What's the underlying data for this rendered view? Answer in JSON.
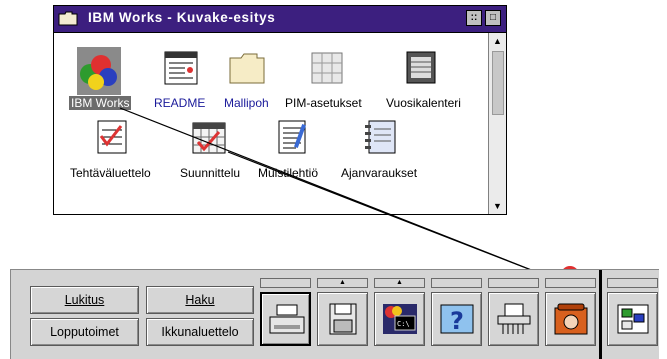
{
  "window": {
    "title": "IBM Works - Kuvake-esitys",
    "restore_glyph": "::",
    "max_glyph": "□"
  },
  "icons": [
    {
      "label": "IBM Works",
      "icon": "ibm-works-balloons-icon",
      "selected": true
    },
    {
      "label": "README",
      "icon": "readme-document-icon"
    },
    {
      "label": "Mallipoh",
      "icon": "folder-icon"
    },
    {
      "label": "PIM-asetukset",
      "icon": "pim-settings-icon"
    },
    {
      "label": "Vuosikalenteri",
      "icon": "year-calendar-icon"
    },
    {
      "label": "Tehtäväluettelo",
      "icon": "task-list-icon"
    },
    {
      "label": "Suunnittelu",
      "icon": "planner-icon"
    },
    {
      "label": "Muistilehtiö",
      "icon": "notepad-icon"
    },
    {
      "label": "Ajanvaraukset",
      "icon": "appointments-icon"
    }
  ],
  "tray": {
    "buttons": {
      "lukitus": "Lukitus",
      "haku": "Haku",
      "lopputoimet": "Lopputoimet",
      "ikkunaluettelo": "Ikkunaluettelo"
    },
    "tools": [
      "printer-icon",
      "floppy-disk-icon",
      "command-prompt-icon",
      "help-icon",
      "shredder-icon",
      "telephone-icon",
      "window-list-icon"
    ]
  }
}
